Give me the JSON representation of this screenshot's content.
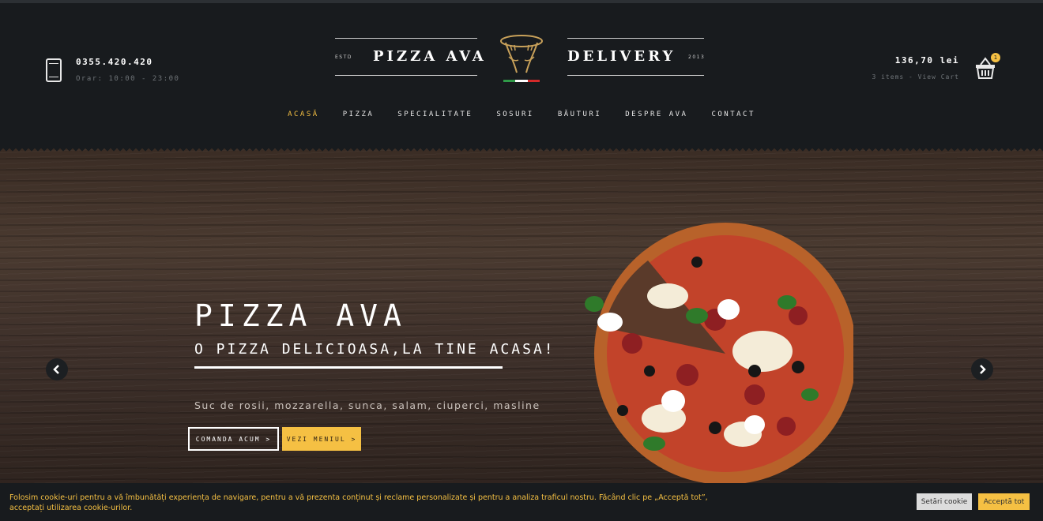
{
  "header": {
    "phone_number": "0355.420.420",
    "phone_hours": "Orar: 10:00 - 23:00",
    "logo": {
      "left_text": "PIZZA AVA",
      "right_text": "DELIVERY",
      "est_left": "ESTD",
      "est_right": "2013"
    },
    "cart": {
      "total": "136,70 lei",
      "subtitle": "3 items - View Cart",
      "badge": "1"
    }
  },
  "nav": {
    "items": [
      {
        "label": "ACASĂ",
        "active": true
      },
      {
        "label": "PIZZA"
      },
      {
        "label": "SPECIALITATE"
      },
      {
        "label": "SOSURI"
      },
      {
        "label": "BĂUTURI"
      },
      {
        "label": "DESPRE AVA"
      },
      {
        "label": "CONTACT"
      }
    ]
  },
  "hero": {
    "title": "PIZZA AVA",
    "subtitle": "O PIZZA DELICIOASA,LA TINE ACASA!",
    "description": "Suc de rosii, mozzarella, sunca, salam, ciuperci, masline",
    "button_order": "COMANDA ACUM >",
    "button_menu": "VEZI MENIUL >"
  },
  "cookie": {
    "text": "Folosim cookie-uri pentru a vă îmbunătăți experiența de navigare, pentru a vă prezenta conținut și reclame personalizate și pentru a analiza traficul nostru. Făcând clic pe „Acceptă tot”, acceptați utilizarea cookie-urilor.",
    "settings_label": "Setări cookie",
    "accept_label": "Acceptă tot"
  },
  "colors": {
    "accent": "#f5c043",
    "header_bg": "#181b1e",
    "muted": "#6f7478",
    "flag_green": "#2f9a48",
    "flag_white": "#ffffff",
    "flag_red": "#d42a2a"
  },
  "icons": [
    "phone-icon",
    "logo-hands-icon",
    "basket-icon",
    "chevron-left-icon",
    "chevron-right-icon"
  ]
}
